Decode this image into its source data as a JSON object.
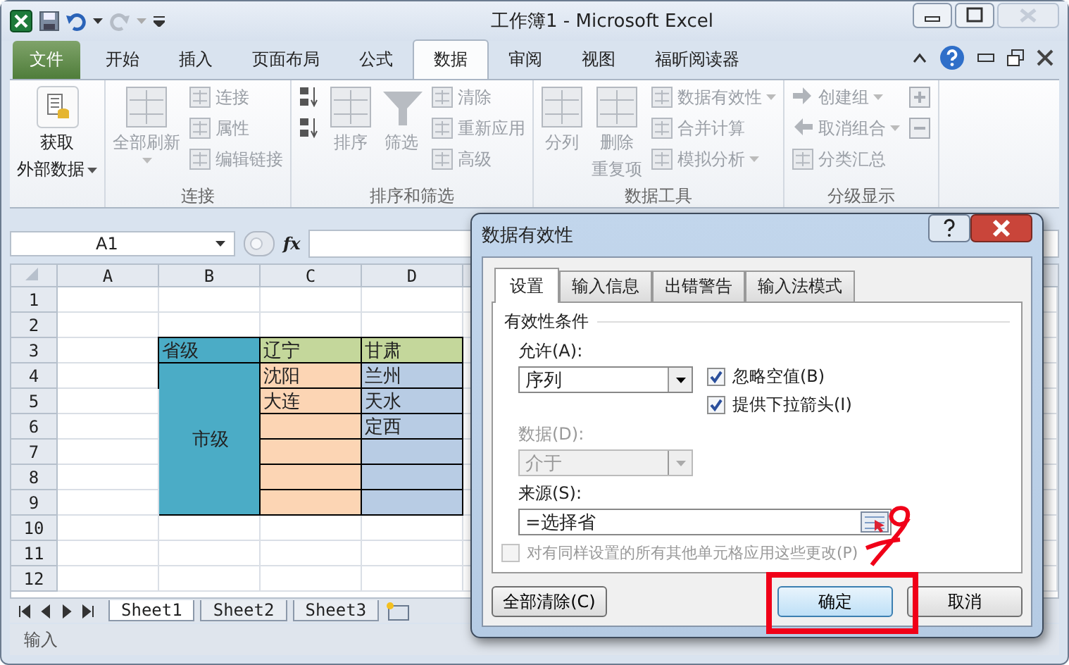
{
  "window": {
    "title": "工作簿1 - Microsoft Excel"
  },
  "tabs": [
    {
      "label": "文件",
      "kind": "file",
      "selected": false
    },
    {
      "label": "开始",
      "kind": "tab",
      "selected": false
    },
    {
      "label": "插入",
      "kind": "tab",
      "selected": false
    },
    {
      "label": "页面布局",
      "kind": "tab",
      "selected": false
    },
    {
      "label": "公式",
      "kind": "tab",
      "selected": false
    },
    {
      "label": "数据",
      "kind": "tab",
      "selected": true
    },
    {
      "label": "审阅",
      "kind": "tab",
      "selected": false
    },
    {
      "label": "视图",
      "kind": "tab",
      "selected": false
    },
    {
      "label": "福昕阅读器",
      "kind": "tab",
      "selected": false
    }
  ],
  "ribbon": {
    "groups": [
      {
        "items": [
          {
            "kind": "large",
            "lines": [
              "获取",
              "外部数据"
            ],
            "dropdown": true,
            "disabled": false
          }
        ]
      },
      {
        "label": "连接",
        "items": [
          {
            "kind": "large",
            "lines": [
              "全部刷新"
            ],
            "dropdown": true,
            "disabled": true
          },
          {
            "kind": "small",
            "label": "连接",
            "disabled": true
          },
          {
            "kind": "small",
            "label": "属性",
            "disabled": true
          },
          {
            "kind": "small",
            "label": "编辑链接",
            "disabled": true
          }
        ]
      },
      {
        "label": "排序和筛选",
        "items": [
          {
            "kind": "icon",
            "disabled": false
          },
          {
            "kind": "icon",
            "disabled": false
          },
          {
            "kind": "large",
            "lines": [
              "排序"
            ],
            "disabled": true
          },
          {
            "kind": "large",
            "lines": [
              "筛选"
            ],
            "disabled": true
          },
          {
            "kind": "small",
            "label": "清除",
            "disabled": true
          },
          {
            "kind": "small",
            "label": "重新应用",
            "disabled": true
          },
          {
            "kind": "small",
            "label": "高级",
            "disabled": true
          }
        ]
      },
      {
        "label": "数据工具",
        "items": [
          {
            "kind": "large",
            "lines": [
              "分列"
            ],
            "disabled": true
          },
          {
            "kind": "large",
            "lines": [
              "删除",
              "重复项"
            ],
            "disabled": true
          },
          {
            "kind": "small",
            "label": "数据有效性",
            "dropdown": true,
            "disabled": true
          },
          {
            "kind": "small",
            "label": "合并计算",
            "disabled": true
          },
          {
            "kind": "small",
            "label": "模拟分析",
            "dropdown": true,
            "disabled": true
          }
        ]
      },
      {
        "label": "分级显示",
        "items": [
          {
            "kind": "small",
            "label": "创建组",
            "dropdown": true,
            "disabled": true
          },
          {
            "kind": "small",
            "label": "取消组合",
            "dropdown": true,
            "disabled": true
          },
          {
            "kind": "small",
            "label": "分类汇总",
            "disabled": true
          },
          {
            "kind": "icon",
            "disabled": true
          },
          {
            "kind": "icon",
            "disabled": true
          }
        ]
      }
    ]
  },
  "formula_bar": {
    "name_box": "A1",
    "function_label": "fx"
  },
  "sheet": {
    "columns": [
      "A",
      "B",
      "C",
      "D"
    ],
    "rows": [
      {
        "header": "1",
        "cells": [
          {},
          {},
          {},
          {}
        ]
      },
      {
        "header": "2",
        "cells": [
          {},
          {},
          {},
          {}
        ]
      },
      {
        "header": "3",
        "cells": [
          {},
          {
            "text": "省级",
            "color": "#4bacc6"
          },
          {
            "text": "辽宁",
            "color": "#c4d79b"
          },
          {
            "text": "甘肃",
            "color": "#c4d79b"
          }
        ]
      },
      {
        "header": "4",
        "cells": [
          {},
          {
            "text": "市级",
            "color": "#4bacc6",
            "kind": "merge_start",
            "rowspan": 6
          },
          {
            "text": "沈阳",
            "color": "#fcd5b4"
          },
          {
            "text": "兰州",
            "color": "#b8cce4"
          }
        ]
      },
      {
        "header": "5",
        "cells": [
          {},
          {
            "text": "大连",
            "color": "#fcd5b4"
          },
          {
            "text": "天水",
            "color": "#b8cce4"
          }
        ]
      },
      {
        "header": "6",
        "cells": [
          {},
          {
            "color": "#fcd5b4"
          },
          {
            "text": "定西",
            "color": "#b8cce4"
          }
        ]
      },
      {
        "header": "7",
        "cells": [
          {},
          {
            "color": "#fcd5b4"
          },
          {
            "color": "#b8cce4"
          }
        ]
      },
      {
        "header": "8",
        "cells": [
          {},
          {
            "color": "#fcd5b4"
          },
          {
            "color": "#b8cce4"
          }
        ]
      },
      {
        "header": "9",
        "cells": [
          {},
          {
            "color": "#fcd5b4"
          },
          {
            "color": "#b8cce4"
          }
        ]
      },
      {
        "header": "10",
        "cells": [
          {},
          {},
          {},
          {}
        ]
      },
      {
        "header": "11",
        "cells": [
          {},
          {},
          {},
          {}
        ]
      },
      {
        "header": "12",
        "cells": [
          {},
          {},
          {},
          {}
        ]
      }
    ],
    "tabs": [
      {
        "label": "Sheet1",
        "selected": true
      },
      {
        "label": "Sheet2",
        "selected": false
      },
      {
        "label": "Sheet3",
        "selected": false
      }
    ]
  },
  "status_bar": {
    "mode": "输入"
  },
  "dialog": {
    "title": "数据有效性",
    "tabs": [
      {
        "label": "设置",
        "selected": true
      },
      {
        "label": "输入信息",
        "selected": false
      },
      {
        "label": "出错警告",
        "selected": false
      },
      {
        "label": "输入法模式",
        "selected": false
      }
    ],
    "section": "有效性条件",
    "allow": {
      "label": "允许(A):",
      "value": "序列",
      "disabled": false
    },
    "options": [
      {
        "label": "忽略空值(B)",
        "checked": true
      },
      {
        "label": "提供下拉箭头(I)",
        "checked": true
      }
    ],
    "data": {
      "label": "数据(D):",
      "value": "介于",
      "disabled": true
    },
    "source": {
      "label": "来源(S):",
      "value": "=选择省"
    },
    "apply_all": {
      "label": "对有同样设置的所有其他单元格应用这些更改(P)",
      "checked": false,
      "disabled": true
    },
    "buttons": [
      {
        "label": "全部清除(C)",
        "kind": "left",
        "default": false
      },
      {
        "label": "确定",
        "kind": "right",
        "default": true
      },
      {
        "label": "取消",
        "kind": "right",
        "default": false
      }
    ]
  }
}
